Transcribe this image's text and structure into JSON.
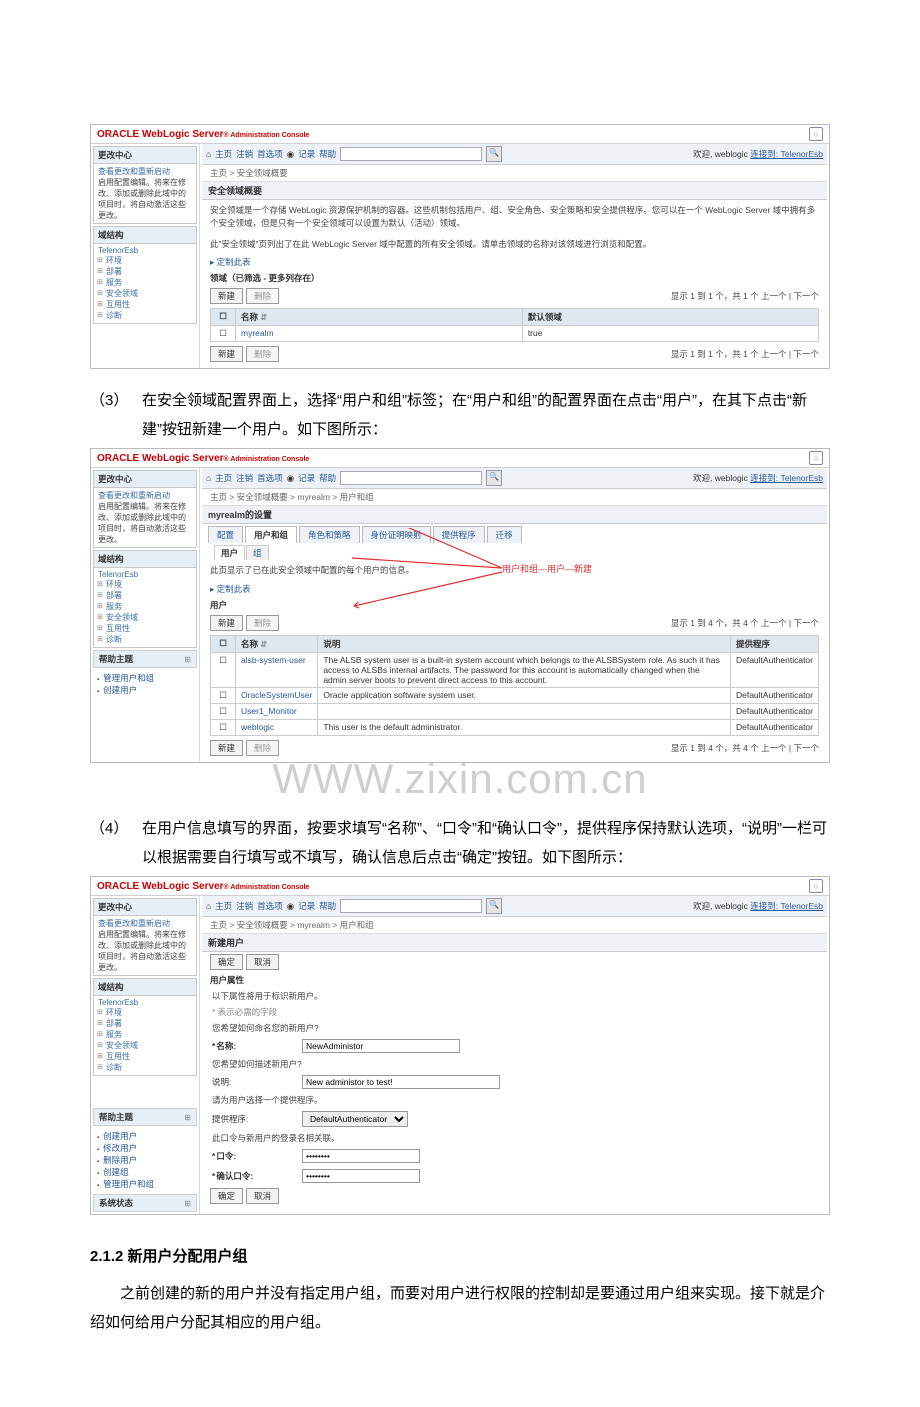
{
  "common": {
    "oracle_brand": "ORACLE",
    "product": " WebLogic Server",
    "suffix": "® Administration Console",
    "welcome_prefix": "欢迎,",
    "welcome_user": "weblogic",
    "connected_to": "连接到: TelenorEsb",
    "toolbar": {
      "home": "主页",
      "logout": "注销",
      "prefs": "首选项",
      "record": "记录",
      "help": "帮助",
      "home_icon": "⌂",
      "record_icon": "◉"
    },
    "left": {
      "change_center": "更改中心",
      "view_changes": "查看更改和重新启动",
      "change_note": "启用配置编辑。将来在修改、添加或删除此域中的项目时，将自动激活这些更改。",
      "domain_struct": "域结构",
      "domain": "TelenorEsb",
      "nodes": [
        "环境",
        "部署",
        "服务",
        "安全领域",
        "互用性",
        "诊断"
      ],
      "help_topic": "帮助主题",
      "sys_state": "系统状态"
    },
    "buttons": {
      "new": "新建",
      "delete": "删除",
      "ok": "确定",
      "cancel": "取消"
    },
    "customize": "▸ 定制此表",
    "breadcrumb_home": "主页"
  },
  "shot1": {
    "breadcrumb": "主页 > 安全领域概要",
    "title": "安全领域概要",
    "para1": "安全领域是一个存储 WebLogic 资源保护机制的容器。这些机制包括用户、组、安全角色、安全策略和安全提供程序。您可以在一个 WebLogic Server 域中拥有多个安全领域，但是只有一个安全领域可以设置为默认（活动）领域。",
    "para2": "此\"安全领域\"页列出了在此 WebLogic Server 域中配置的所有安全领域。请单击领域的名称对该领域进行浏览和配置。",
    "table_caption": "领域（已筛选 - 更多列存在）",
    "cols": {
      "name": "名称",
      "default": "默认领域"
    },
    "row": {
      "name": "myrealm",
      "default": "true"
    },
    "pager": "显示 1 到 1 个，共 1 个 上一个 | 下一个"
  },
  "step3": "在安全领域配置界面上，选择“用户和组”标签；在“用户和组”的配置界面在点击“用户”，在其下点击“新建”按钮新建一个用户。如下图所示：",
  "step3_num": "（3）",
  "shot2": {
    "breadcrumb": "主页 > 安全领域概要 > myrealm > 用户和组",
    "title": "myrealm的设置",
    "tabs": [
      "配置",
      "用户和组",
      "角色和策略",
      "身份证明映射",
      "提供程序",
      "迁移"
    ],
    "subtabs": [
      "用户",
      "组"
    ],
    "para": "此页显示了已在此安全领域中配置的每个用户的信息。",
    "annotation": "用户和组—用户—新建",
    "table_caption": "用户",
    "cols": {
      "name": "名称",
      "desc": "说明",
      "provider": "提供程序"
    },
    "rows": [
      {
        "name": "alsb-system-user",
        "desc": "The ALSB system user is a built-in system account which belongs to the ALSBSystem role. As such it has access to ALSBs internal artifacts. The password for this account is automatically changed when the admin server boots to prevent direct access to this account.",
        "provider": "DefaultAuthenticator"
      },
      {
        "name": "OracleSystemUser",
        "desc": "Oracle application software system user.",
        "provider": "DefaultAuthenticator"
      },
      {
        "name": "User1_Monitor",
        "desc": "",
        "provider": "DefaultAuthenticator"
      },
      {
        "name": "weblogic",
        "desc": "This user is the default administrator.",
        "provider": "DefaultAuthenticator"
      }
    ],
    "pager": "显示 1 到 4 个，共 4 个 上一个 | 下一个",
    "help_items": [
      "管理用户和组",
      "创建用户"
    ]
  },
  "watermark": "WWW.zixin.com.cn",
  "step4": "在用户信息填写的界面，按要求填写“名称”、“口令”和“确认口令”，提供程序保持默认选项，“说明”一栏可以根据需要自行填写或不填写，确认信息后点击“确定”按钮。如下图所示：",
  "step4_num": "（4）",
  "shot3": {
    "breadcrumb": "主页 > 安全领域概要 > myrealm > 用户和组",
    "title": "新建用户",
    "props_title": "用户属性",
    "note1": "以下属性将用于标识新用户。",
    "note2": "* 表示必需的字段",
    "q1": "您希望如何命名您的新用户?",
    "f_name": "名称:",
    "v_name": "NewAdministor",
    "q2": "您希望如何描述新用户?",
    "f_desc": "说明:",
    "v_desc": "New administor to test!",
    "q3": "请为用户选择一个提供程序。",
    "f_provider": "提供程序:",
    "v_provider": "DefaultAuthenticator",
    "note3": "此口令与新用户的登录名相关联。",
    "f_pw": "口令:",
    "f_pw2": "确认口令:",
    "v_pw": "●●●●●●●●",
    "help_items": [
      "创建用户",
      "修改用户",
      "删除用户",
      "创建组",
      "管理用户和组"
    ]
  },
  "section_2_1_2": "2.1.2 新用户分配用户组",
  "section_body": "之前创建的新的用户并没有指定用户组，而要对用户进行权限的控制却是要通过用户组来实现。接下就是介绍如何给用户分配其相应的用户组。"
}
